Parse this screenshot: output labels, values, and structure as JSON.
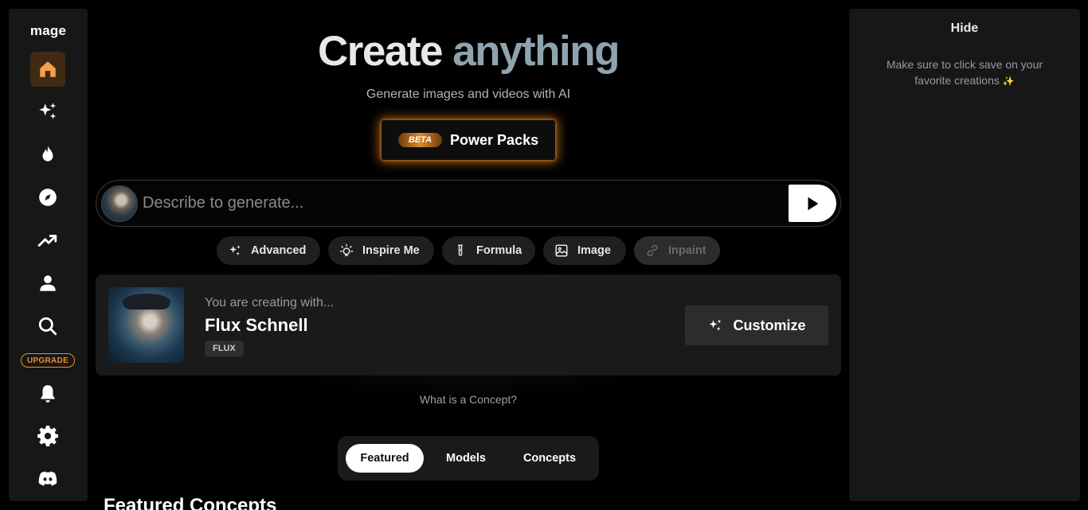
{
  "sidebar": {
    "logo": "mage",
    "upgrade_label": "UPGRADE",
    "items": [
      {
        "name": "home",
        "icon": "home-icon"
      },
      {
        "name": "create",
        "icon": "sparkles-icon"
      },
      {
        "name": "trending",
        "icon": "flame-icon"
      },
      {
        "name": "explore",
        "icon": "compass-icon"
      },
      {
        "name": "top",
        "icon": "trending-up-icon"
      },
      {
        "name": "profile",
        "icon": "user-icon"
      },
      {
        "name": "search",
        "icon": "search-icon"
      },
      {
        "name": "notifications",
        "icon": "bell-icon"
      },
      {
        "name": "settings",
        "icon": "gear-icon"
      },
      {
        "name": "discord",
        "icon": "discord-icon"
      }
    ]
  },
  "hero": {
    "title_word1": "Create",
    "title_word2": "anything",
    "subtitle": "Generate images and videos with AI",
    "power_badge": "BETA",
    "power_label": "Power Packs"
  },
  "prompt": {
    "placeholder": "Describe to generate..."
  },
  "chips": [
    {
      "label": "Advanced",
      "icon": "sparkles-icon",
      "disabled": false
    },
    {
      "label": "Inspire Me",
      "icon": "lightbulb-icon",
      "disabled": false
    },
    {
      "label": "Formula",
      "icon": "test-tube-icon",
      "disabled": false
    },
    {
      "label": "Image",
      "icon": "image-icon",
      "disabled": false
    },
    {
      "label": "Inpaint",
      "icon": "link-icon",
      "disabled": true
    }
  ],
  "creating": {
    "label": "You are creating with...",
    "model_name": "Flux Schnell",
    "model_tag": "FLUX",
    "customize_label": "Customize"
  },
  "concept_link": "What is a Concept?",
  "tabs": [
    {
      "label": "Featured",
      "active": true
    },
    {
      "label": "Models",
      "active": false
    },
    {
      "label": "Concepts",
      "active": false
    }
  ],
  "section_title": "Featured Concepts",
  "right_panel": {
    "hide_label": "Hide",
    "hint": "Make sure to click save on your favorite creations",
    "hint_emoji": "✨"
  },
  "colors": {
    "accent_orange": "#f08a2e",
    "active_nav_bg": "#3f2a14",
    "title_highlight": "#8ea3ad"
  }
}
